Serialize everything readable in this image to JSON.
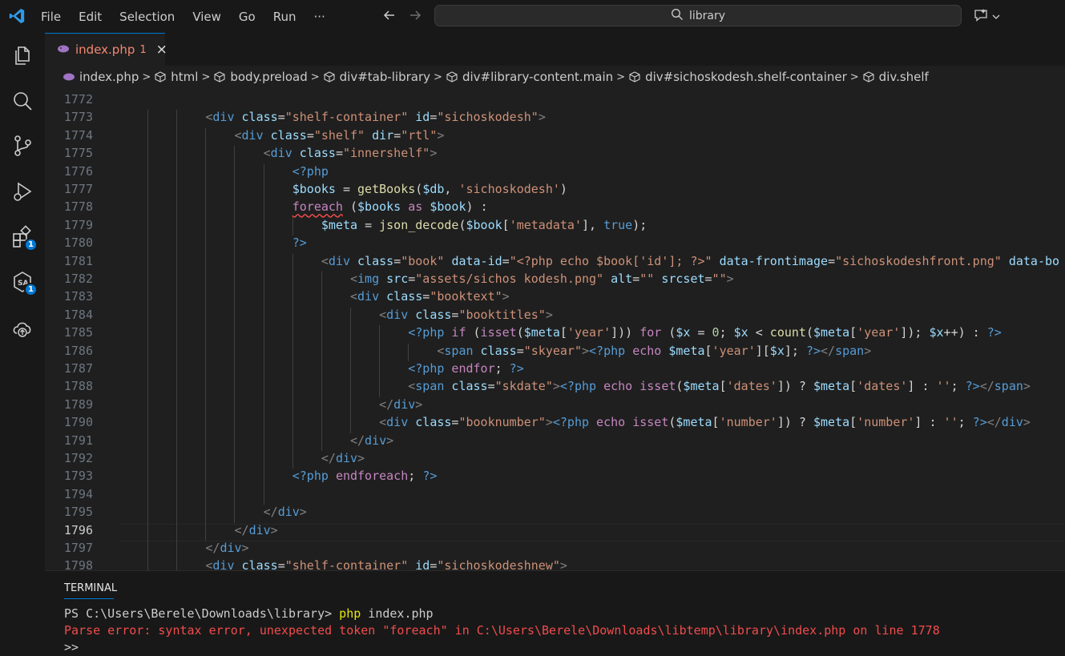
{
  "menu": [
    "File",
    "Edit",
    "Selection",
    "View",
    "Go",
    "Run",
    "···"
  ],
  "search": {
    "text": "library"
  },
  "tab": {
    "filename": "index.php",
    "problems": "1",
    "close": "×"
  },
  "breadcrumb": [
    "index.php",
    "html",
    "body.preload",
    "div#tab-library",
    "div#library-content.main",
    "div#sichoskodesh.shelf-container",
    "div.shelf"
  ],
  "badges": {
    "extensions": "1",
    "source_control_ext": "1"
  },
  "editor": {
    "line_numbers": [
      "1772",
      "1773",
      "1774",
      "1775",
      "1776",
      "1777",
      "1778",
      "1779",
      "1780",
      "1781",
      "1782",
      "1783",
      "1784",
      "1785",
      "1786",
      "1787",
      "1788",
      "1789",
      "1790",
      "1791",
      "1792",
      "1793",
      "1794",
      "1795",
      "1796",
      "1797",
      "1798"
    ],
    "active_line": "1796",
    "lines": [
      "",
      "            <div class=\"shelf-container\" id=\"sichoskodesh\">",
      "                <div class=\"shelf\" dir=\"rtl\">",
      "                    <div class=\"innershelf\">",
      "                        <?php",
      "                        $books = getBooks($db, 'sichoskodesh')",
      "                        foreach ($books as $book) :",
      "                            $meta = json_decode($book['metadata'], true);",
      "                        ?>",
      "                            <div class=\"book\" data-id=\"<?php echo $book['id']; ?>\" data-frontimage=\"sichoskodeshfront.png\" data-bo",
      "                                <img src=\"assets/sichos kodesh.png\" alt=\"\" srcset=\"\">",
      "                                <div class=\"booktext\">",
      "                                    <div class=\"booktitles\">",
      "                                        <?php if (isset($meta['year'])) for ($x = 0; $x < count($meta['year']); $x++) : ?>",
      "                                            <span class=\"skyear\"><?php echo $meta['year'][$x]; ?></span>",
      "                                        <?php endfor; ?>",
      "                                        <span class=\"skdate\"><?php echo isset($meta['dates']) ? $meta['dates'] : ''; ?></span>",
      "                                    </div>",
      "                                    <div class=\"booknumber\"><?php echo isset($meta['number']) ? $meta['number'] : ''; ?></div>",
      "                                </div>",
      "                            </div>",
      "                        <?php endforeach; ?>",
      "",
      "                    </div>",
      "                </div>",
      "            </div>",
      "            <div class=\"shelf-container\" id=\"sichoskodeshnew\">"
    ]
  },
  "panel": {
    "tab": "TERMINAL",
    "prompt": "PS C:\\Users\\Berele\\Downloads\\library> ",
    "command": "php",
    "args": " index.php",
    "error": "Parse error: syntax error, unexpected token \"foreach\" in C:\\Users\\Berele\\Downloads\\libtemp\\library\\index.php on line 1778",
    "next_prompt": ">>"
  }
}
